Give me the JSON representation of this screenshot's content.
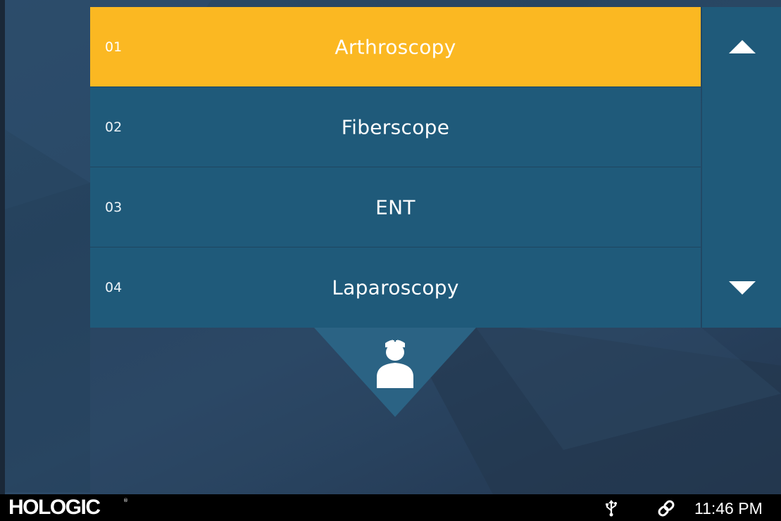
{
  "procedure_list": {
    "items": [
      {
        "number": "01",
        "label": "Arthroscopy",
        "selected": true
      },
      {
        "number": "02",
        "label": "Fiberscope",
        "selected": false
      },
      {
        "number": "03",
        "label": "ENT",
        "selected": false
      },
      {
        "number": "04",
        "label": "Laparoscopy",
        "selected": false
      }
    ]
  },
  "scroll": {
    "up_icon": "triangle-up-icon",
    "down_icon": "triangle-down-icon"
  },
  "user_tab": {
    "icon": "nurse-icon"
  },
  "taskbar": {
    "brand": "HOLOGIC",
    "brand_mark": "®",
    "usb_icon": "usb-icon",
    "link_icon": "link-icon",
    "time": "11:46 PM"
  },
  "colors": {
    "selected_row": "#fbb822",
    "row": "#1f5a7a",
    "background": "#2b4a66",
    "taskbar": "#000000"
  }
}
